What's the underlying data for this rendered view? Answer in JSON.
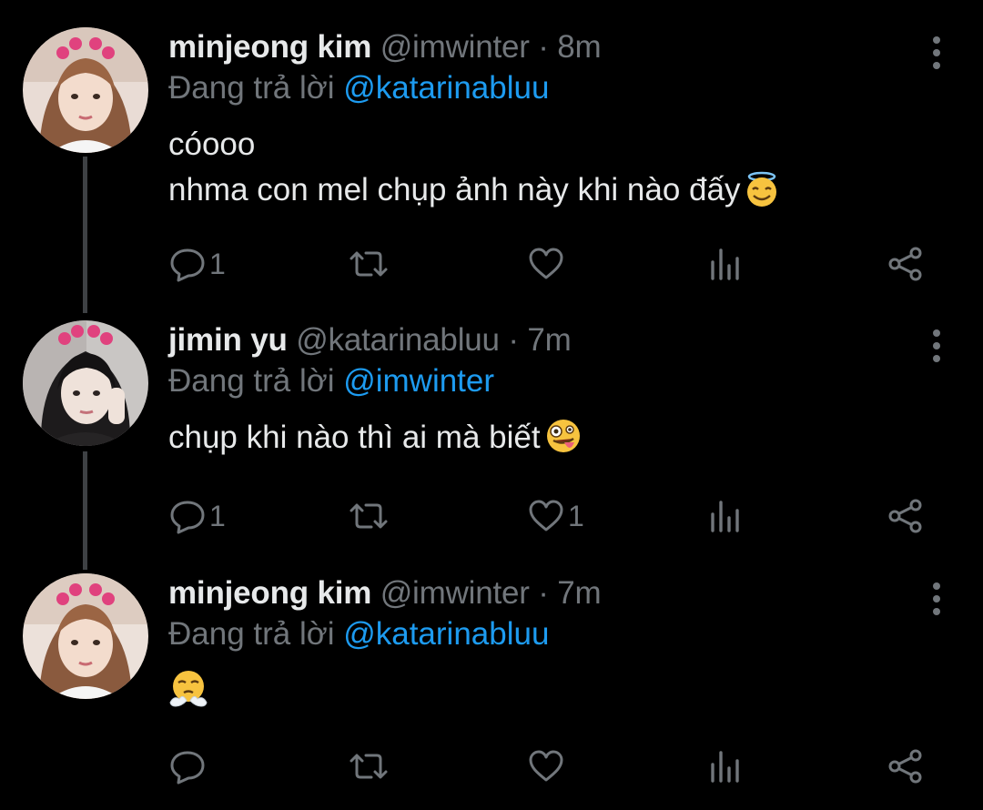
{
  "colors": {
    "background": "#000000",
    "text": "#e7e9ea",
    "muted": "#71767b",
    "mention": "#1d9bf0",
    "thread_line": "#3e4144"
  },
  "tweets": [
    {
      "display_name": "minjeong kim",
      "handle": "@imwinter",
      "separator": "·",
      "time": "8m",
      "reply_prefix": "Đang trả lời",
      "reply_to": "@katarinabluu",
      "text": "cóooo\nnhma con mel chụp ảnh này khi nào đấy",
      "emoji": "smiling-face-with-halo",
      "reply_count": "1",
      "retweet_count": "",
      "like_count": "",
      "icons": [
        "reply-icon",
        "retweet-icon",
        "like-icon",
        "views-icon",
        "share-icon",
        "more-icon"
      ]
    },
    {
      "display_name": "jimin yu",
      "handle": "@katarinabluu",
      "separator": "·",
      "time": "7m",
      "reply_prefix": "Đang trả lời",
      "reply_to": "@imwinter",
      "text": "chụp khi nào thì ai mà biết",
      "emoji": "zany-face",
      "reply_count": "1",
      "retweet_count": "",
      "like_count": "1",
      "icons": [
        "reply-icon",
        "retweet-icon",
        "like-icon",
        "views-icon",
        "share-icon",
        "more-icon"
      ]
    },
    {
      "display_name": "minjeong kim",
      "handle": "@imwinter",
      "separator": "·",
      "time": "7m",
      "reply_prefix": "Đang trả lời",
      "reply_to": "@katarinabluu",
      "text": "",
      "emoji": "face-with-steam-from-nose",
      "reply_count": "",
      "retweet_count": "",
      "like_count": "",
      "icons": [
        "reply-icon",
        "retweet-icon",
        "like-icon",
        "views-icon",
        "share-icon",
        "more-icon"
      ]
    }
  ]
}
